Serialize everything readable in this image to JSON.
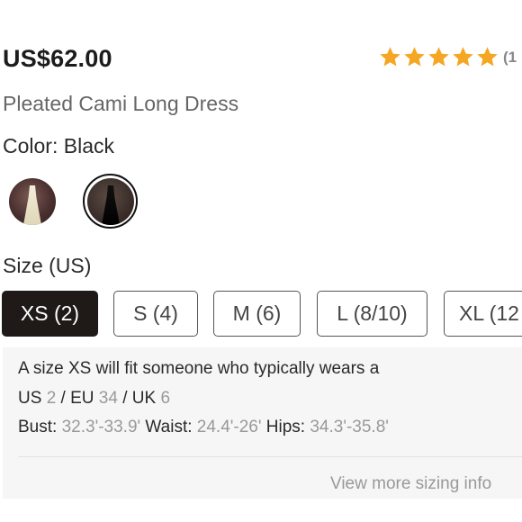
{
  "product": {
    "price": "US$62.00",
    "rating_count": "(1",
    "rating_stars": 5,
    "title": "Pleated Cami Long Dress",
    "color_label": "Color:",
    "color_value": "Black"
  },
  "swatches": [
    {
      "name": "white-dress-swatch",
      "selected": false
    },
    {
      "name": "black-dress-swatch",
      "selected": true
    }
  ],
  "size": {
    "label": "Size (US)",
    "options": [
      "XS (2)",
      "S (4)",
      "M (6)",
      "L (8/10)",
      "XL (12"
    ],
    "selected": "XS (2)"
  },
  "fit_info": {
    "intro": "A size XS will fit someone who typically wears a",
    "us_label": "US",
    "us_value": "2",
    "eu_label": "/ EU",
    "eu_value": "34",
    "uk_label": "/ UK",
    "uk_value": "6",
    "bust_label": "Bust:",
    "bust_value": "32.3'-33.9'",
    "waist_label": "Waist:",
    "waist_value": "24.4'-26'",
    "hips_label": "Hips:",
    "hips_value": "34.3'-35.8'",
    "more_link": "View more sizing info"
  },
  "colors": {
    "star": "#F5A623",
    "selected_bg": "#1F1A17",
    "info_bg": "#F6F6F6"
  }
}
